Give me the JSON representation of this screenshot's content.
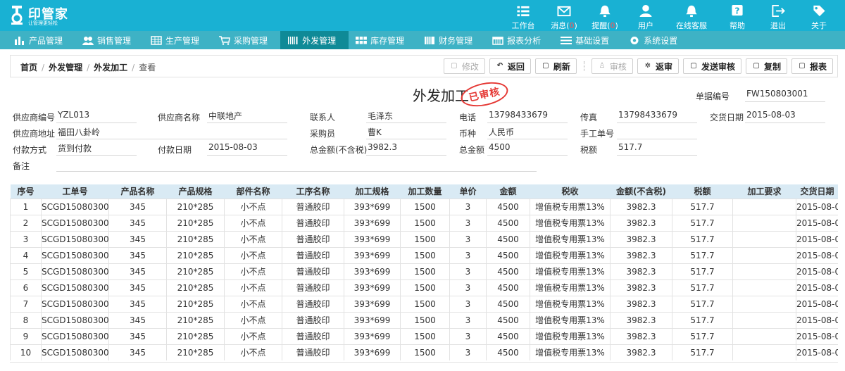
{
  "app": {
    "logo_name": "印管家",
    "logo_slogan": "让管理更轻松"
  },
  "topnav": [
    {
      "label": "工作台",
      "icon": "workbench-icon"
    },
    {
      "label": "消息(",
      "badge": "0",
      "suffix": ")",
      "icon": "envelope-icon"
    },
    {
      "label": "提醒(",
      "badge": "0",
      "suffix": ")",
      "icon": "bell-icon"
    },
    {
      "label": "用户",
      "icon": "user-icon"
    },
    {
      "label": "在线客服",
      "icon": "bell-service-icon"
    },
    {
      "label": "帮助",
      "icon": "help-icon"
    },
    {
      "label": "退出",
      "icon": "exit-icon"
    },
    {
      "label": "关于",
      "icon": "tag-icon"
    }
  ],
  "modules": [
    {
      "label": "产品管理",
      "active": false
    },
    {
      "label": "销售管理",
      "active": false
    },
    {
      "label": "生产管理",
      "active": false
    },
    {
      "label": "采购管理",
      "active": false
    },
    {
      "label": "外发管理",
      "active": true
    },
    {
      "label": "库存管理",
      "active": false
    },
    {
      "label": "财务管理",
      "active": false
    },
    {
      "label": "报表分析",
      "active": false
    },
    {
      "label": "基础设置",
      "active": false
    },
    {
      "label": "系统设置",
      "active": false
    }
  ],
  "breadcrumb": {
    "home": "首页",
    "section": "外发管理",
    "page": "外发加工",
    "current": "查看"
  },
  "toolbar": {
    "edit": "修改",
    "back": "返回",
    "refresh": "刷新",
    "audit": "审核",
    "unaudit": "返审",
    "send_audit": "发送审核",
    "copy": "复制",
    "report": "报表"
  },
  "form": {
    "title": "外发加工",
    "stamp": "已审核",
    "doc_no_label": "单据编号",
    "doc_no": "FW150803001",
    "supplier_code_label": "供应商编号",
    "supplier_code": "YZL013",
    "supplier_name_label": "供应商名称",
    "supplier_name": "中联地产",
    "contact_label": "联系人",
    "contact": "毛泽东",
    "phone_label": "电话",
    "phone": "13798433679",
    "fax_label": "传真",
    "fax": "13798433679",
    "delivery_date_label": "交货日期",
    "delivery_date": "2015-08-03",
    "supplier_addr_label": "供应商地址",
    "supplier_addr": "福田八卦岭",
    "buyer_label": "采购员",
    "buyer": "曹K",
    "currency_label": "币种",
    "currency": "人民币",
    "manual_no_label": "手工单号",
    "manual_no": "",
    "payment_method_label": "付款方式",
    "payment_method": "货到付款",
    "payment_date_label": "付款日期",
    "payment_date": "2015-08-03",
    "total_ex_tax_label": "总金额(不含税)",
    "total_ex_tax": "3982.3",
    "total_label": "总金额",
    "total": "4500",
    "tax_label": "税额",
    "tax": "517.7",
    "remark_label": "备注",
    "remark": ""
  },
  "table": {
    "headers": [
      "序号",
      "工单号",
      "产品名称",
      "产品规格",
      "部件名称",
      "工序名称",
      "加工规格",
      "加工数量",
      "单价",
      "金额",
      "税收",
      "金额(不含税)",
      "税额",
      "加工要求",
      "交货日期"
    ],
    "rows": [
      [
        "1",
        "SCGD150803001",
        "345",
        "210*285",
        "小不点",
        "普通胶印",
        "393*699",
        "1500",
        "3",
        "4500",
        "增值税专用票13%",
        "3982.3",
        "517.7",
        "",
        "2015-08-0"
      ],
      [
        "2",
        "SCGD150803001",
        "345",
        "210*285",
        "小不点",
        "普通胶印",
        "393*699",
        "1500",
        "3",
        "4500",
        "增值税专用票13%",
        "3982.3",
        "517.7",
        "",
        "2015-08-0"
      ],
      [
        "3",
        "SCGD150803001",
        "345",
        "210*285",
        "小不点",
        "普通胶印",
        "393*699",
        "1500",
        "3",
        "4500",
        "增值税专用票13%",
        "3982.3",
        "517.7",
        "",
        "2015-08-0"
      ],
      [
        "4",
        "SCGD150803001",
        "345",
        "210*285",
        "小不点",
        "普通胶印",
        "393*699",
        "1500",
        "3",
        "4500",
        "增值税专用票13%",
        "3982.3",
        "517.7",
        "",
        "2015-08-0"
      ],
      [
        "5",
        "SCGD150803001",
        "345",
        "210*285",
        "小不点",
        "普通胶印",
        "393*699",
        "1500",
        "3",
        "4500",
        "增值税专用票13%",
        "3982.3",
        "517.7",
        "",
        "2015-08-0"
      ],
      [
        "6",
        "SCGD150803001",
        "345",
        "210*285",
        "小不点",
        "普通胶印",
        "393*699",
        "1500",
        "3",
        "4500",
        "增值税专用票13%",
        "3982.3",
        "517.7",
        "",
        "2015-08-0"
      ],
      [
        "7",
        "SCGD150803001",
        "345",
        "210*285",
        "小不点",
        "普通胶印",
        "393*699",
        "1500",
        "3",
        "4500",
        "增值税专用票13%",
        "3982.3",
        "517.7",
        "",
        "2015-08-0"
      ],
      [
        "8",
        "SCGD150803001",
        "345",
        "210*285",
        "小不点",
        "普通胶印",
        "393*699",
        "1500",
        "3",
        "4500",
        "增值税专用票13%",
        "3982.3",
        "517.7",
        "",
        "2015-08-0"
      ],
      [
        "9",
        "SCGD150803001",
        "345",
        "210*285",
        "小不点",
        "普通胶印",
        "393*699",
        "1500",
        "3",
        "4500",
        "增值税专用票13%",
        "3982.3",
        "517.7",
        "",
        "2015-08-0"
      ],
      [
        "10",
        "SCGD150803001",
        "345",
        "210*285",
        "小不点",
        "普通胶印",
        "393*699",
        "1500",
        "3",
        "4500",
        "增值税专用票13%",
        "3982.3",
        "517.7",
        "",
        "2015-08-0"
      ]
    ]
  }
}
